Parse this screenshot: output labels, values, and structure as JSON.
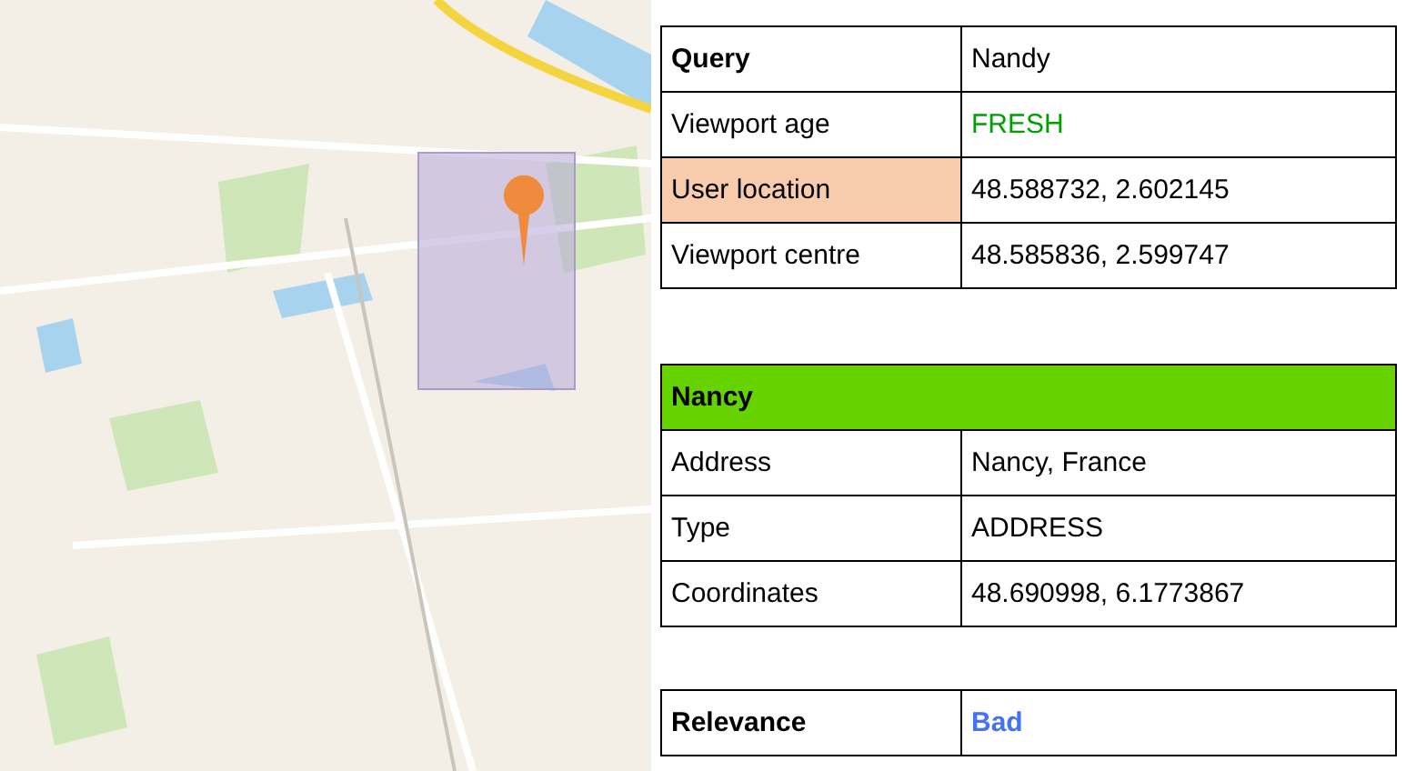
{
  "query_table": {
    "rows": [
      {
        "label": "Query",
        "value": "Nandy",
        "bold": true,
        "highlighted": false
      },
      {
        "label": "Viewport age",
        "value": "FRESH",
        "bold": false,
        "highlighted": false,
        "color": "#00a000"
      },
      {
        "label": "User location",
        "value": "48.588732, 2.602145",
        "bold": false,
        "highlighted": true
      },
      {
        "label": "Viewport centre",
        "value": "48.585836, 2.599747",
        "bold": false,
        "highlighted": false
      }
    ]
  },
  "result_table": {
    "title": "Nancy",
    "rows": [
      {
        "label": "Address",
        "value": "Nancy, France",
        "bold": false,
        "highlighted": false
      },
      {
        "label": "Type",
        "value": "ADDRESS",
        "bold": false,
        "highlighted": false
      },
      {
        "label": "Coordinates",
        "value": "48.690998, 6.1773867",
        "bold": false,
        "highlighted": false
      }
    ]
  },
  "relevance_table": {
    "rows": [
      {
        "label": "Relevance",
        "value": "Bad",
        "bold": true,
        "highlighted": false,
        "color": "#4472f0"
      }
    ]
  }
}
